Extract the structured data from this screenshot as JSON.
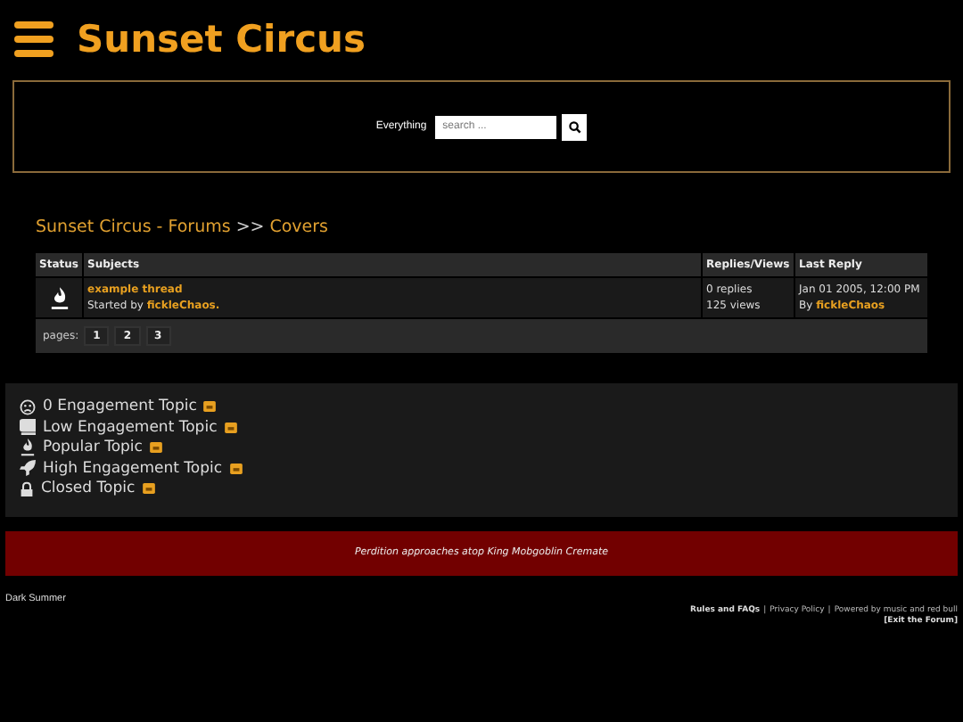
{
  "header": {
    "title": "Sunset Circus"
  },
  "search": {
    "scope": "Everything",
    "placeholder": "search ..."
  },
  "breadcrumb": [
    {
      "label": "Sunset Circus - Forums"
    },
    {
      "label": "Covers"
    }
  ],
  "breadcrumb_separator": ">>",
  "table": {
    "columns": [
      "Status",
      "Subjects",
      "Replies/Views",
      "Last Reply"
    ],
    "rows": [
      {
        "subject": "example thread",
        "started_prefix": "Started by",
        "author": "fickleChaos.",
        "replies": "0 replies",
        "views": "125 views",
        "last_date": "Jan 01 2005, 12:00 PM",
        "last_prefix": "By",
        "last_author": "fickleChaos"
      }
    ],
    "pages_label": "pages:",
    "pages": [
      "1",
      "2",
      "3"
    ]
  },
  "legend": [
    {
      "kind": "frown",
      "label": "0 Engagement Topic"
    },
    {
      "kind": "book",
      "label": "Low Engagement Topic"
    },
    {
      "kind": "torch",
      "label": "Popular Topic"
    },
    {
      "kind": "rocket",
      "label": "High Engagement Topic"
    },
    {
      "kind": "lock",
      "label": "Closed Topic"
    }
  ],
  "banner": "Perdition approaches atop King Mobgoblin Cremate",
  "footer": {
    "theme": "Dark Summer",
    "links": [
      "Rules and FAQs",
      "Privacy Policy",
      "Powered by music and red bull"
    ],
    "separator": "|",
    "exit": "[Exit the Forum]"
  }
}
